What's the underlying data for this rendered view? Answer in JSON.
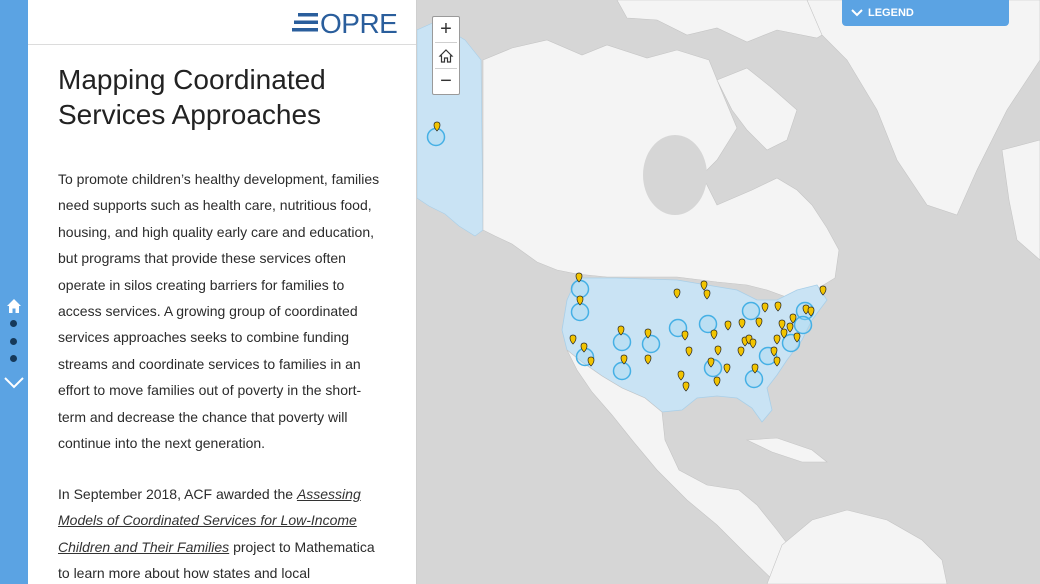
{
  "sidebar_nav": {
    "icons": [
      "home-icon",
      "dot",
      "dot",
      "dot",
      "chevron-down-icon"
    ],
    "accent_color": "#5ba3e3"
  },
  "header": {
    "logo_text": "OPRE"
  },
  "story": {
    "title": "Mapping Coordinated Services Approaches",
    "paragraph1": "To promote children’s healthy development, families need supports such as health care, nutritious food, housing, and high quality early care and education, but programs that provide these services often operate in silos creating barriers for families to access services. A growing group of coordinated services approaches seeks to combine funding streams and coordinate services to families in an effort to move families out of poverty in the short-term and decrease the chance that poverty will continue into the next generation.",
    "paragraph2_prefix": "In September 2018, ACF awarded the ",
    "paragraph2_link": "Assessing Models of Coordinated Services for Low-Income Children and Their Families",
    "paragraph2_suffix": " project to Mathematica to learn more about how states and local"
  },
  "map": {
    "zoom_in_label": "+",
    "zoom_out_label": "−",
    "home_icon": "home-icon",
    "legend_label": "LEGEND",
    "colors": {
      "water": "#d6d6d6",
      "land": "#f4f4f4",
      "us": "#c9e3f4",
      "marker": "#f2c400",
      "circle": "#45b0e5"
    }
  }
}
